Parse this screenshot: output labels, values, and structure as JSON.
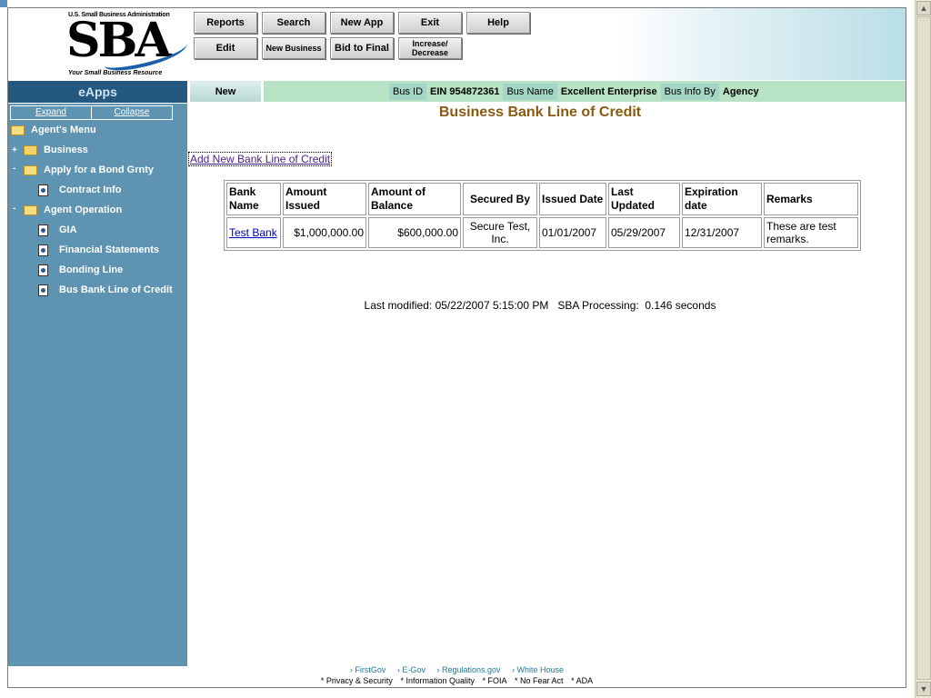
{
  "header": {
    "logo_top": "U.S. Small Business Administration",
    "logo_main": "SBA",
    "logo_tagline": "Your Small Business Resource"
  },
  "toolbar": {
    "row1": [
      {
        "label": "Reports"
      },
      {
        "label": "Search"
      },
      {
        "label": "New App"
      },
      {
        "label": "Exit"
      },
      {
        "label": "Help"
      }
    ],
    "row2": [
      {
        "label": "Edit"
      },
      {
        "label": "New Business"
      },
      {
        "label": "Bid to Final"
      },
      {
        "label": "Increase/ Decrease"
      }
    ]
  },
  "sidebar": {
    "title": "eApps",
    "expand": "Expand",
    "collapse": "Collapse",
    "items": [
      {
        "label": "Agent's Menu"
      },
      {
        "label": "Business"
      },
      {
        "label": "Apply for a Bond Grnty"
      },
      {
        "label": "Contract Info"
      },
      {
        "label": "Agent Operation"
      },
      {
        "label": "GIA"
      },
      {
        "label": "Financial Statements"
      },
      {
        "label": "Bonding Line"
      },
      {
        "label": "Bus Bank Line of Credit"
      }
    ]
  },
  "infobar": {
    "status": "New",
    "bus_id_label": "Bus ID",
    "ein": "EIN  954872361",
    "bus_name_label": "Bus Name",
    "bus_name": "Excellent Enterprise",
    "info_by_label": "Bus Info By",
    "info_by": "Agency"
  },
  "main": {
    "title": "Business Bank Line of Credit",
    "add_link": "Add New Bank Line of Credit",
    "table": {
      "headers": [
        "Bank Name",
        "Amount Issued",
        "Amount of Balance",
        "Secured By",
        "Issued Date",
        "Last Updated",
        "Expiration date",
        "Remarks"
      ],
      "rows": [
        [
          "Test Bank",
          "$1,000,000.00",
          "$600,000.00",
          "Secure Test, Inc.",
          "01/01/2007",
          "05/29/2007",
          "12/31/2007",
          "These are test remarks."
        ]
      ]
    },
    "modified": "Last modified: 05/22/2007 5:15:00 PM   SBA Processing:  0.146 seconds"
  },
  "footer": {
    "links": [
      "› FirstGov",
      "› E-Gov",
      "› Regulations.gov",
      "› White House"
    ],
    "policy": [
      "* Privacy & Security",
      "* Information Quality",
      "* FOIA",
      "* No Fear Act",
      "* ADA"
    ]
  },
  "colors": {
    "sidebar": "#5e93b2",
    "sidebar_title": "#24587e",
    "infobar": "#b7e2c4",
    "title": "#8a5a12"
  }
}
